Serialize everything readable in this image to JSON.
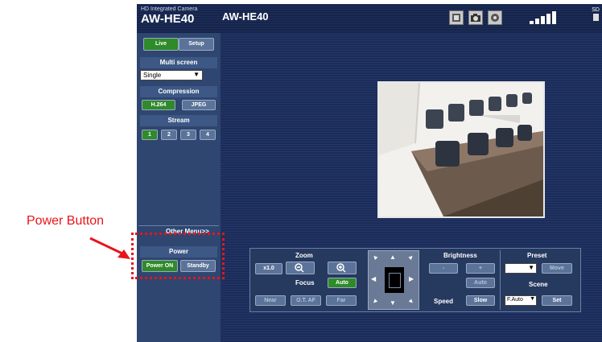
{
  "header": {
    "brand_small": "HD Integrated Camera",
    "brand_large": "AW-HE40",
    "model": "AW-HE40",
    "sd_label": "SD",
    "top_icons": [
      "snapshot-icon",
      "camera-icon",
      "settings-icon",
      "signal-strength-icon"
    ]
  },
  "tabs": {
    "live": "Live",
    "setup": "Setup"
  },
  "multi_screen": {
    "title": "Multi screen",
    "value": "Single"
  },
  "compression": {
    "title": "Compression",
    "h264": "H.264",
    "jpeg": "JPEG"
  },
  "stream": {
    "title": "Stream",
    "items": [
      "1",
      "2",
      "3",
      "4"
    ]
  },
  "other_menu": "Other Menu>>",
  "power": {
    "title": "Power",
    "on": "Power ON",
    "standby": "Standby"
  },
  "controls": {
    "zoom": {
      "title": "Zoom",
      "x1": "x1.0"
    },
    "focus": {
      "title": "Focus",
      "auto": "Auto",
      "near": "Near",
      "otaf": "O.T. AF",
      "far": "Far"
    },
    "brightness": {
      "title": "Brightness",
      "minus": "-",
      "plus": "+",
      "auto": "Auto"
    },
    "speed": {
      "title": "Speed",
      "value": "Slow"
    },
    "preset": {
      "title": "Preset",
      "value": "",
      "move": "Move"
    },
    "scene": {
      "title": "Scene",
      "value": "F.Auto",
      "set": "Set"
    }
  },
  "annotation": {
    "label": "Power Button"
  },
  "colors": {
    "active_green": "#2f8a2a",
    "app_bg": "#16244a",
    "annotation": "#e8141b"
  }
}
